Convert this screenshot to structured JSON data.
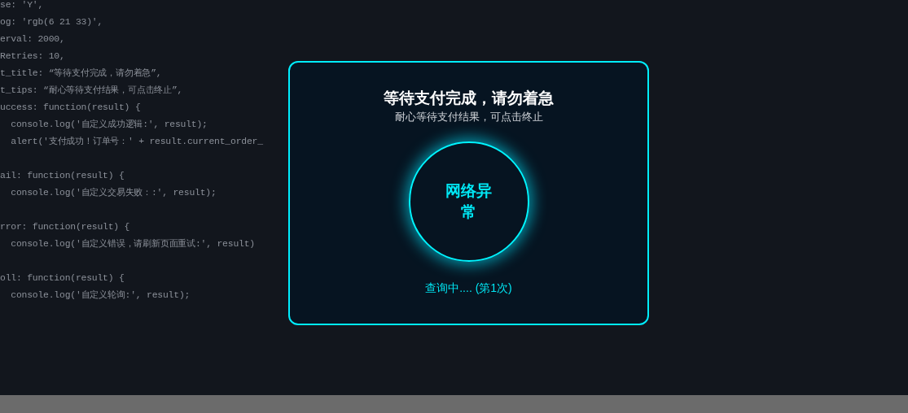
{
  "code_blocks": [
    {
      "lines": [
        "se: 'Y',",
        "og: 'rgb(6 21 33)',",
        "erval: 2000,",
        "Retries: 10,",
        "t_title: “等待支付完成，请勿着急”,",
        "t_tips: “耐心等待支付结果，可点击终止”,",
        "uccess: function(result) {",
        "  console.log('自定义成功逻辑:', result);",
        "  alert('支付成功！订单号：' + result.current_order_"
      ]
    },
    {
      "lines": [
        "ail: function(result) {",
        "  console.log('自定义交易失败：:', result);"
      ]
    },
    {
      "lines": [
        "rror: function(result) {",
        "  console.log('自定义错误，请刷新页面重试:', result)"
      ]
    },
    {
      "lines": [
        "oll: function(result) {",
        "  console.log('自定义轮询:', result);"
      ]
    }
  ],
  "dialog": {
    "title": "等待支付完成，请勿着急",
    "tips": "耐心等待支付结果，可点击终止",
    "circle_text": "网络异常",
    "status": "查询中.... (第1次)"
  }
}
